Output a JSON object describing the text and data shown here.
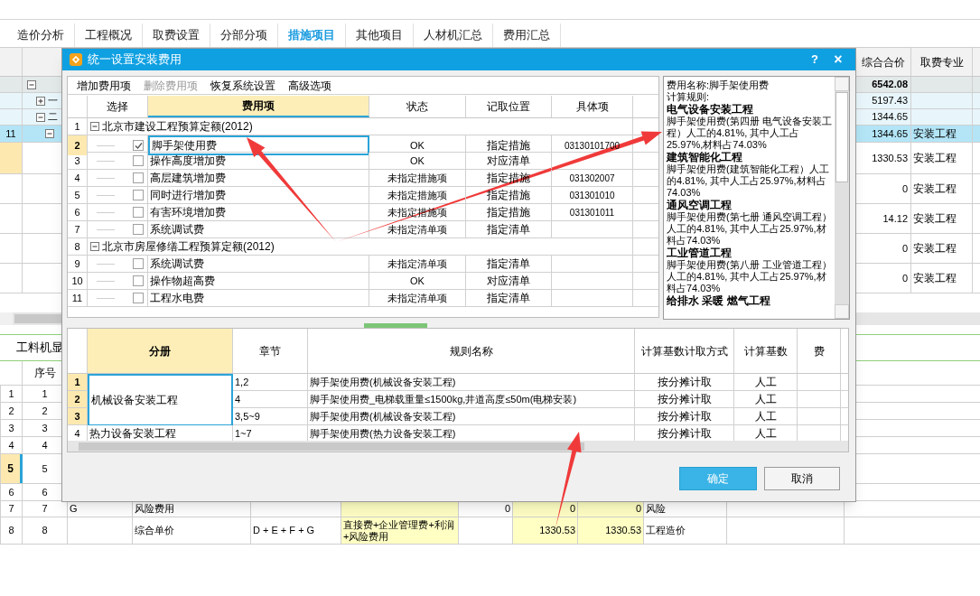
{
  "top_tabs": [
    {
      "label": "造价分析",
      "selected": false
    },
    {
      "label": "工程概况",
      "selected": false
    },
    {
      "label": "取费设置",
      "selected": false
    },
    {
      "label": "分部分项",
      "selected": false
    },
    {
      "label": "措施项目",
      "selected": true
    },
    {
      "label": "其他项目",
      "selected": false
    },
    {
      "label": "人材机汇总",
      "selected": false
    },
    {
      "label": "费用汇总",
      "selected": false
    }
  ],
  "main_table": {
    "columns": [
      "综合合价",
      "取费专业"
    ],
    "rows": [
      {
        "kind": "summary",
        "expanded": true,
        "total": "6542.08",
        "selected": false,
        "focused": false,
        "children": [
          {
            "kind": "group",
            "code": "一",
            "expanded": false,
            "total": "5197.43",
            "selected": false,
            "focused": false
          },
          {
            "kind": "group",
            "code": "二",
            "expanded": true,
            "total": "1344.65",
            "selected": false,
            "focused": false,
            "children": [
              {
                "kind": "item",
                "num": "11",
                "expanded": true,
                "total": "1344.65",
                "specialty": "安装工程",
                "selected": true,
                "focused": false,
                "children": [
                  {
                    "kind": "leaf",
                    "total": "1330.53",
                    "specialty": "安装工程",
                    "selected": false,
                    "focused": true
                  },
                  {
                    "kind": "leaf",
                    "total": "0",
                    "specialty": "安装工程",
                    "selected": false,
                    "focused": false
                  },
                  {
                    "kind": "leaf",
                    "total": "14.12",
                    "specialty": "安装工程",
                    "selected": false,
                    "focused": false
                  },
                  {
                    "kind": "leaf",
                    "total": "0",
                    "specialty": "安装工程",
                    "selected": false,
                    "focused": false
                  },
                  {
                    "kind": "leaf",
                    "total": "0",
                    "specialty": "安装工程",
                    "selected": false,
                    "focused": false
                  }
                ]
              }
            ]
          }
        ]
      }
    ]
  },
  "lower_panel": {
    "tab": "工料机显",
    "seq_header": "序号",
    "rows": [
      {
        "num": "1",
        "seq": "1",
        "selected": false
      },
      {
        "num": "2",
        "seq": "2",
        "selected": false
      },
      {
        "num": "3",
        "seq": "3",
        "selected": false
      },
      {
        "num": "4",
        "seq": "4",
        "selected": false
      },
      {
        "num": "5",
        "seq": "5",
        "selected": true
      },
      {
        "num": "6",
        "seq": "6",
        "selected": false
      },
      {
        "num": "7",
        "seq": "7",
        "selected": false,
        "code": "G",
        "name": "风险费用",
        "amount": "0",
        "unit_price": "0",
        "total": "0",
        "fee_type": "风险"
      },
      {
        "num": "8",
        "seq": "8",
        "selected": false,
        "name": "综合单价",
        "formula": "D + E + F + G",
        "base": "直接费+企业管理费+利润+风险费用",
        "unit_price": "1330.53",
        "total": "1330.53",
        "fee_type": "工程造价"
      }
    ]
  },
  "dialog": {
    "title": "统一设置安装费用",
    "help": "?",
    "close": "×",
    "menu": [
      {
        "label": "增加费用项",
        "disabled": false
      },
      {
        "label": "删除费用项",
        "disabled": true
      },
      {
        "label": "恢复系统设置",
        "disabled": false
      },
      {
        "label": "高级选项",
        "disabled": false
      }
    ],
    "fee_table": {
      "columns": [
        "选择",
        "费用项",
        "状态",
        "记取位置",
        "具体项"
      ],
      "groups": [
        {
          "num": "1",
          "label": "北京市建设工程预算定额(2012)",
          "expanded": true,
          "children": [
            {
              "num": "2",
              "checked": true,
              "selected": true,
              "name": "脚手架使用费",
              "status": "OK",
              "position": "指定措施",
              "detail": "03130101700"
            },
            {
              "num": "3",
              "checked": false,
              "selected": false,
              "name": "操作高度增加费",
              "status": "OK",
              "position": "对应清单"
            },
            {
              "num": "4",
              "checked": false,
              "selected": false,
              "name": "高层建筑增加费",
              "status": "未指定措施项",
              "position": "指定措施",
              "detail": "031302007"
            },
            {
              "num": "5",
              "checked": false,
              "selected": false,
              "name": "同时进行增加费",
              "status": "未指定措施项",
              "position": "指定措施",
              "detail": "031301010"
            },
            {
              "num": "6",
              "checked": false,
              "selected": false,
              "name": "有害环境增加费",
              "status": "未指定措施项",
              "position": "指定措施",
              "detail": "031301011"
            },
            {
              "num": "7",
              "checked": false,
              "selected": false,
              "name": "系统调试费",
              "status": "未指定清单项",
              "position": "指定清单"
            }
          ]
        },
        {
          "num": "8",
          "label": "北京市房屋修缮工程预算定额(2012)",
          "expanded": true,
          "children": [
            {
              "num": "9",
              "checked": false,
              "selected": false,
              "name": "系统调试费",
              "status": "未指定清单项",
              "position": "指定清单"
            },
            {
              "num": "10",
              "checked": false,
              "selected": false,
              "name": "操作物超高费",
              "status": "OK",
              "position": "对应清单"
            },
            {
              "num": "11",
              "checked": false,
              "selected": false,
              "name": "工程水电费",
              "status": "未指定清单项",
              "position": "指定清单"
            }
          ]
        }
      ]
    },
    "info": [
      {
        "kind": "text",
        "text": "费用名称:脚手架使用费"
      },
      {
        "kind": "text",
        "text": "计算规则:"
      },
      {
        "kind": "heading",
        "text": "电气设备安装工程"
      },
      {
        "kind": "text",
        "text": "脚手架使用费(第四册 电气设备安装工程）人工的4.81%, 其中人工占25.97%,材料占74.03%"
      },
      {
        "kind": "heading",
        "text": "建筑智能化工程"
      },
      {
        "kind": "text",
        "text": "脚手架使用费(建筑智能化工程）人工的4.81%, 其中人工占25.97%,材料占74.03%"
      },
      {
        "kind": "heading",
        "text": "通风空调工程"
      },
      {
        "kind": "text",
        "text": "脚手架使用费(第七册 通风空调工程）人工的4.81%, 其中人工占25.97%,材料占74.03%"
      },
      {
        "kind": "heading",
        "text": "工业管道工程"
      },
      {
        "kind": "text",
        "text": "脚手架使用费(第八册 工业管道工程）人工的4.81%, 其中人工占25.97%,材料占74.03%"
      },
      {
        "kind": "heading",
        "text": "给排水 采暖 燃气工程"
      }
    ],
    "rule_table": {
      "columns": [
        "分册",
        "章节",
        "规则名称",
        "计算基数计取方式",
        "计算基数",
        "费"
      ],
      "groups": [
        {
          "name": "机械设备安装工程",
          "selected": true,
          "rows": [
            {
              "num": "1",
              "chapter": "1,2",
              "rule": "脚手架使用费(机械设备安装工程)",
              "method": "按分摊计取",
              "base": "人工"
            },
            {
              "num": "2",
              "chapter": "4",
              "rule": "脚手架使用费_电梯载重量≤1500kg,井道高度≤50m(电梯安装)",
              "method": "按分摊计取",
              "base": "人工"
            },
            {
              "num": "3",
              "chapter": "3,5~9",
              "rule": "脚手架使用费(机械设备安装工程)",
              "method": "按分摊计取",
              "base": "人工"
            }
          ]
        },
        {
          "name": "热力设备安装工程",
          "selected": false,
          "rows": [
            {
              "num": "4",
              "chapter": "1~7",
              "rule": "脚手架使用费(热力设备安装工程)",
              "method": "按分摊计取",
              "base": "人工"
            }
          ]
        }
      ]
    },
    "buttons": [
      {
        "label": "确定",
        "kind": "primary"
      },
      {
        "label": "取消",
        "kind": "secondary"
      }
    ]
  }
}
